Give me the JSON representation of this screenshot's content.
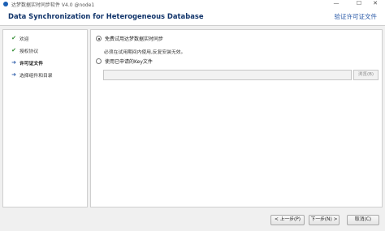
{
  "window": {
    "title": "达梦数据实时同步软件 V4.0 @node1",
    "controls": {
      "minimize": "—",
      "maximize": "☐",
      "close": "✕"
    }
  },
  "header": {
    "title": "Data Synchronization for Heterogeneous Database",
    "subtitle": "验证许可证文件"
  },
  "sidebar": {
    "steps": [
      {
        "label": "欢迎",
        "state": "done"
      },
      {
        "label": "授权协议",
        "state": "done"
      },
      {
        "label": "许可证文件",
        "state": "current"
      },
      {
        "label": "选择组件和目录",
        "state": "pending"
      }
    ]
  },
  "main": {
    "option_trial": {
      "label": "免费试用达梦数据实时同步",
      "selected": true
    },
    "trial_hint": "必须在试用期间内使用,反复安装无效。",
    "option_key": {
      "label": "使用已申请的Key文件",
      "selected": false
    },
    "key_path": {
      "value": "",
      "placeholder": ""
    },
    "browse_label": "浏览(B)"
  },
  "footer": {
    "prev_label": "< 上一步(P)",
    "next_label": "下一步(N) >",
    "cancel_label": "取消(C)"
  },
  "colors": {
    "header_title": "#12356b",
    "header_subtitle": "#2a5aa8",
    "check": "#2e8b2e",
    "current_arrow": "#2a5aa8"
  }
}
